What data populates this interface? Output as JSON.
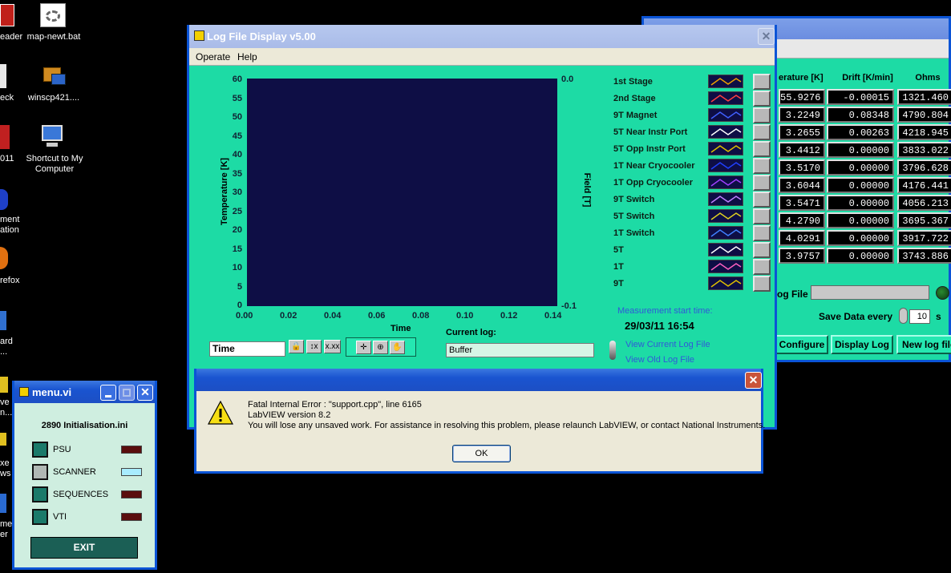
{
  "desktop": {
    "icons": [
      {
        "label": "eader",
        "icon": "pdf-reader-icon"
      },
      {
        "label": "map-newt.bat",
        "icon": "batch-file-icon"
      },
      {
        "label": "eck",
        "icon": "document-icon"
      },
      {
        "label": "winscp421....",
        "icon": "winscp-icon"
      },
      {
        "label": "011",
        "icon": "app-icon"
      },
      {
        "label": "Shortcut to My Computer",
        "icon": "computer-icon"
      },
      {
        "label": "ment",
        "icon": "app-icon"
      },
      {
        "label": "ation",
        "icon": "app-icon"
      },
      {
        "label": "refox",
        "icon": "firefox-icon"
      },
      {
        "label": "ard",
        "icon": "app-icon"
      },
      {
        "label": "...",
        "icon": "app-icon"
      },
      {
        "label": "ve",
        "icon": "app-icon"
      },
      {
        "label": "n...",
        "icon": "app-icon"
      },
      {
        "label": "xe",
        "icon": "app-icon"
      },
      {
        "label": "ws",
        "icon": "app-icon"
      },
      {
        "label": "me",
        "icon": "app-icon"
      },
      {
        "label": "er",
        "icon": "app-icon"
      }
    ]
  },
  "logwin": {
    "title": "Log File Display v5.00",
    "menu": [
      "Operate",
      "Help"
    ],
    "chart": {
      "yticks": [
        "60",
        "55",
        "50",
        "45",
        "40",
        "35",
        "30",
        "25",
        "20",
        "15",
        "10",
        "5",
        "0"
      ],
      "xticks": [
        "0.00",
        "0.02",
        "0.04",
        "0.06",
        "0.08",
        "0.10",
        "0.12",
        "0.14"
      ],
      "right_top": "0.0",
      "right_bottom": "-0.1",
      "ylabel": "Temperature [K]",
      "y2label": "Field [T]",
      "xlabel": "Time"
    },
    "legend": [
      {
        "name": "1st Stage",
        "color": "#f0a000"
      },
      {
        "name": "2nd Stage",
        "color": "#ff4040"
      },
      {
        "name": "9T Magnet",
        "color": "#4060ff"
      },
      {
        "name": "5T Near Instr Port",
        "color": "#ffffff"
      },
      {
        "name": "5T Opp Instr Port",
        "color": "#e0c000"
      },
      {
        "name": "1T Near Cryocooler",
        "color": "#2040ff"
      },
      {
        "name": "1T Opp Cryocooler",
        "color": "#a040ff"
      },
      {
        "name": "9T Switch",
        "color": "#c080ff"
      },
      {
        "name": "5T Switch",
        "color": "#e0d020"
      },
      {
        "name": "1T Switch",
        "color": "#4080ff"
      },
      {
        "name": "5T",
        "color": "#ffffff"
      },
      {
        "name": "1T",
        "color": "#ff60c0"
      },
      {
        "name": "9T",
        "color": "#e0c000"
      }
    ],
    "start_label": "Measurement start time:",
    "start_time": "29/03/11 16:54",
    "current_log_label": "Current log:",
    "current_log": "Buffer",
    "time_field": "Time",
    "view_current": "View Current Log File",
    "view_old": "View Old Log File"
  },
  "bgwin": {
    "headers": [
      "erature [K]",
      "Drift [K/min]",
      "Ohms"
    ],
    "rows": [
      [
        "55.9276",
        "-0.00015",
        "1321.460"
      ],
      [
        "3.2249",
        "0.08348",
        "4790.804"
      ],
      [
        "3.2655",
        "0.00263",
        "4218.945"
      ],
      [
        "3.4412",
        "0.00000",
        "3833.022"
      ],
      [
        "3.5170",
        "0.00000",
        "3796.628"
      ],
      [
        "3.6044",
        "0.00000",
        "4176.441"
      ],
      [
        "3.5471",
        "0.00000",
        "4056.213"
      ],
      [
        "4.2790",
        "0.00000",
        "3695.367"
      ],
      [
        "4.0291",
        "0.00000",
        "3917.722"
      ],
      [
        "3.9757",
        "0.00000",
        "3743.886"
      ]
    ],
    "logfile_label": "og File",
    "save_label": "Save Data every",
    "save_value": "10",
    "save_unit": "s",
    "buttons": [
      "Configure",
      "Display Log",
      "New log file"
    ]
  },
  "menuwin": {
    "title": "menu.vi",
    "file": "2890 Initialisation.ini",
    "items": [
      {
        "label": "PSU",
        "state": "off"
      },
      {
        "label": "SCANNER",
        "state": "on"
      },
      {
        "label": "SEQUENCES",
        "state": "off"
      },
      {
        "label": "VTI",
        "state": "off"
      }
    ],
    "exit": "EXIT"
  },
  "dialog": {
    "line1": "Fatal Internal Error : \"support.cpp\", line 6165",
    "line2": "LabVIEW version 8.2",
    "line3": "You will lose any unsaved work.  For assistance in resolving this problem, please relaunch LabVIEW, or contact National Instruments.",
    "ok": "OK"
  }
}
